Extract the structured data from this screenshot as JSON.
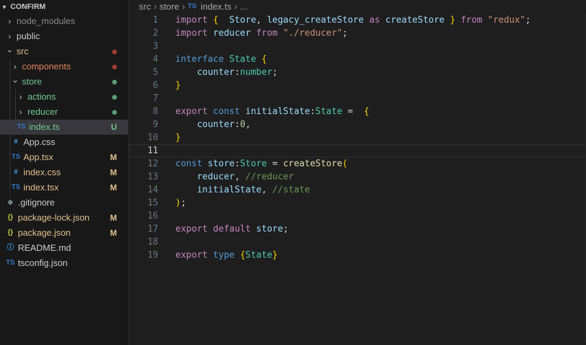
{
  "explorer": {
    "root": "CONFIRM",
    "items": [
      {
        "label": "node_modules",
        "kind": "folder",
        "expanded": false,
        "indent": 0,
        "color": "#8b8b8b",
        "status": "",
        "status_color": ""
      },
      {
        "label": "public",
        "kind": "folder",
        "expanded": false,
        "indent": 0,
        "color": "#cccccc",
        "status": "",
        "status_color": ""
      },
      {
        "label": "src",
        "kind": "folder",
        "expanded": true,
        "indent": 0,
        "color": "#e2c08d",
        "status": "dot",
        "status_color": "#c74e39"
      },
      {
        "label": "components",
        "kind": "folder",
        "expanded": false,
        "indent": 1,
        "color": "#e2855e",
        "status": "dot",
        "status_color": "#c74e39"
      },
      {
        "label": "store",
        "kind": "folder",
        "expanded": true,
        "indent": 1,
        "color": "#73c991",
        "status": "dot",
        "status_color": "#73c991"
      },
      {
        "label": "actions",
        "kind": "folder",
        "expanded": false,
        "indent": 2,
        "color": "#73c991",
        "status": "dot",
        "status_color": "#73c991"
      },
      {
        "label": "reducer",
        "kind": "folder",
        "expanded": false,
        "indent": 2,
        "color": "#73c991",
        "status": "dot",
        "status_color": "#73c991"
      },
      {
        "label": "index.ts",
        "kind": "file",
        "icon": "TS",
        "icon_color": "#3178c6",
        "indent": 2,
        "color": "#73c991",
        "status": "U",
        "status_color": "#73c991",
        "selected": true
      },
      {
        "label": "App.css",
        "kind": "file",
        "icon": "#",
        "icon_color": "#42a5f5",
        "indent": 1,
        "color": "#cccccc",
        "status": "",
        "status_color": ""
      },
      {
        "label": "App.tsx",
        "kind": "file",
        "icon": "TS",
        "icon_color": "#3178c6",
        "indent": 1,
        "color": "#e2c08d",
        "status": "M",
        "status_color": "#e2c08d"
      },
      {
        "label": "index.css",
        "kind": "file",
        "icon": "#",
        "icon_color": "#42a5f5",
        "indent": 1,
        "color": "#e2c08d",
        "status": "M",
        "status_color": "#e2c08d"
      },
      {
        "label": "index.tsx",
        "kind": "file",
        "icon": "TS",
        "icon_color": "#3178c6",
        "indent": 1,
        "color": "#e2c08d",
        "status": "M",
        "status_color": "#e2c08d"
      },
      {
        "label": ".gitignore",
        "kind": "file",
        "icon": "◆",
        "icon_color": "#6d8086",
        "indent": 0,
        "color": "#cccccc",
        "status": "",
        "status_color": ""
      },
      {
        "label": "package-lock.json",
        "kind": "file",
        "icon": "{}",
        "icon_color": "#cbcb41",
        "indent": 0,
        "color": "#e2c08d",
        "status": "M",
        "status_color": "#e2c08d"
      },
      {
        "label": "package.json",
        "kind": "file",
        "icon": "{}",
        "icon_color": "#cbcb41",
        "indent": 0,
        "color": "#e2c08d",
        "status": "M",
        "status_color": "#e2c08d"
      },
      {
        "label": "README.md",
        "kind": "file",
        "icon": "ⓘ",
        "icon_color": "#42a5f5",
        "indent": 0,
        "color": "#cccccc",
        "status": "",
        "status_color": ""
      },
      {
        "label": "tsconfig.json",
        "kind": "file",
        "icon": "TS",
        "icon_color": "#3178c6",
        "indent": 0,
        "color": "#cccccc",
        "status": "",
        "status_color": ""
      }
    ]
  },
  "breadcrumb": {
    "parts": [
      "src",
      "store"
    ],
    "file_icon": "TS",
    "file": "index.ts",
    "tail": "..."
  },
  "editor": {
    "current_line": 11,
    "lines": [
      [
        [
          "kw",
          "import"
        ],
        [
          "p",
          " "
        ],
        [
          "br1",
          "{"
        ],
        [
          "p",
          "  "
        ],
        [
          "var",
          "Store"
        ],
        [
          "p",
          ", "
        ],
        [
          "var",
          "legacy_createStore"
        ],
        [
          "p",
          " "
        ],
        [
          "kw",
          "as"
        ],
        [
          "p",
          " "
        ],
        [
          "var",
          "createStore"
        ],
        [
          "p",
          " "
        ],
        [
          "br1",
          "}"
        ],
        [
          "p",
          " "
        ],
        [
          "kw",
          "from"
        ],
        [
          "p",
          " "
        ],
        [
          "str",
          "\"redux\""
        ],
        [
          "p",
          ";"
        ]
      ],
      [
        [
          "kw",
          "import"
        ],
        [
          "p",
          " "
        ],
        [
          "var",
          "reducer"
        ],
        [
          "p",
          " "
        ],
        [
          "kw",
          "from"
        ],
        [
          "p",
          " "
        ],
        [
          "str",
          "\"./reducer\""
        ],
        [
          "p",
          ";"
        ]
      ],
      [],
      [
        [
          "kb",
          "interface"
        ],
        [
          "p",
          " "
        ],
        [
          "ty",
          "State"
        ],
        [
          "p",
          " "
        ],
        [
          "br1",
          "{"
        ]
      ],
      [
        [
          "p",
          "    "
        ],
        [
          "var",
          "counter"
        ],
        [
          "p",
          ":"
        ],
        [
          "ty",
          "number"
        ],
        [
          "p",
          ";"
        ]
      ],
      [
        [
          "br1",
          "}"
        ]
      ],
      [],
      [
        [
          "kw",
          "export"
        ],
        [
          "p",
          " "
        ],
        [
          "kb",
          "const"
        ],
        [
          "p",
          " "
        ],
        [
          "var",
          "initialState"
        ],
        [
          "p",
          ":"
        ],
        [
          "ty",
          "State"
        ],
        [
          "p",
          " =  "
        ],
        [
          "br1",
          "{"
        ]
      ],
      [
        [
          "p",
          "    "
        ],
        [
          "var",
          "counter"
        ],
        [
          "p",
          ":"
        ],
        [
          "num",
          "0"
        ],
        [
          "p",
          ","
        ]
      ],
      [
        [
          "br1",
          "}"
        ]
      ],
      [],
      [
        [
          "kb",
          "const"
        ],
        [
          "p",
          " "
        ],
        [
          "var",
          "store"
        ],
        [
          "p",
          ":"
        ],
        [
          "ty",
          "Store"
        ],
        [
          "p",
          " = "
        ],
        [
          "fn",
          "createStore"
        ],
        [
          "br1",
          "("
        ]
      ],
      [
        [
          "p",
          "    "
        ],
        [
          "var",
          "reducer"
        ],
        [
          "p",
          ", "
        ],
        [
          "cm",
          "//reducer"
        ]
      ],
      [
        [
          "p",
          "    "
        ],
        [
          "var",
          "initialState"
        ],
        [
          "p",
          ", "
        ],
        [
          "cm",
          "//state"
        ]
      ],
      [
        [
          "br1",
          ")"
        ],
        [
          "p",
          ";"
        ]
      ],
      [],
      [
        [
          "kw",
          "export"
        ],
        [
          "p",
          " "
        ],
        [
          "kw",
          "default"
        ],
        [
          "p",
          " "
        ],
        [
          "var",
          "store"
        ],
        [
          "p",
          ";"
        ]
      ],
      [],
      [
        [
          "kw",
          "export"
        ],
        [
          "p",
          " "
        ],
        [
          "kb",
          "type"
        ],
        [
          "p",
          " "
        ],
        [
          "br1",
          "{"
        ],
        [
          "ty",
          "State"
        ],
        [
          "br1",
          "}"
        ]
      ]
    ]
  }
}
